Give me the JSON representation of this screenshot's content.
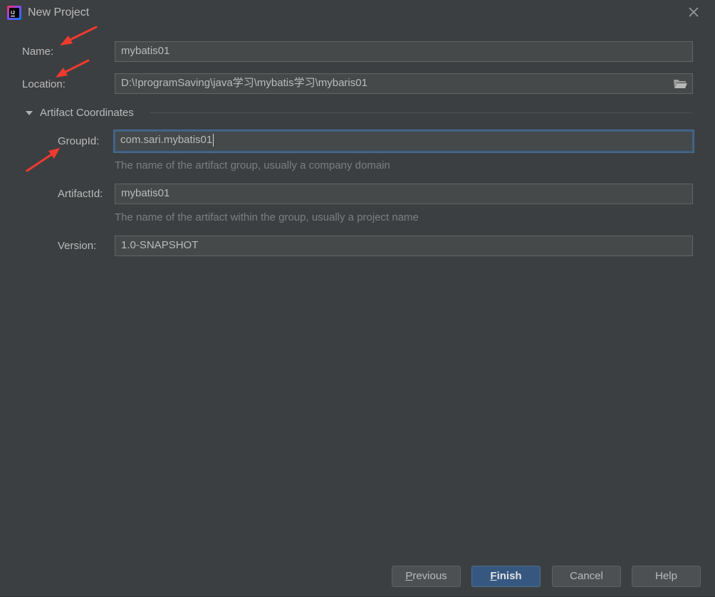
{
  "window": {
    "title": "New Project"
  },
  "form": {
    "name_label": "Name:",
    "name_value": "mybatis01",
    "location_label": "Location:",
    "location_value": "D:\\!programSaving\\java学习\\mybatis学习\\mybaris01"
  },
  "artifact": {
    "section_title": "Artifact Coordinates",
    "groupid_label": "GroupId:",
    "groupid_value": "com.sari.mybatis01",
    "groupid_hint": "The name of the artifact group, usually a company domain",
    "artifactid_label": "ArtifactId:",
    "artifactid_value": "mybatis01",
    "artifactid_hint": "The name of the artifact within the group, usually a project name",
    "version_label": "Version:",
    "version_value": "1.0-SNAPSHOT"
  },
  "buttons": {
    "previous_mnemonic": "P",
    "previous_rest": "revious",
    "finish_mnemonic": "F",
    "finish_rest": "inish",
    "cancel": "Cancel",
    "help": "Help"
  },
  "icons": {
    "app": "intellij-idea-icon",
    "close": "close-icon",
    "folder": "folder-open-icon",
    "collapse": "triangle-down-icon",
    "annotation": "red-arrow-icon"
  },
  "colors": {
    "background": "#3c3f41",
    "field_bg": "#45494a",
    "focus_border": "#3d6185",
    "primary_button": "#365880",
    "annotation_red": "#f03a2e"
  }
}
